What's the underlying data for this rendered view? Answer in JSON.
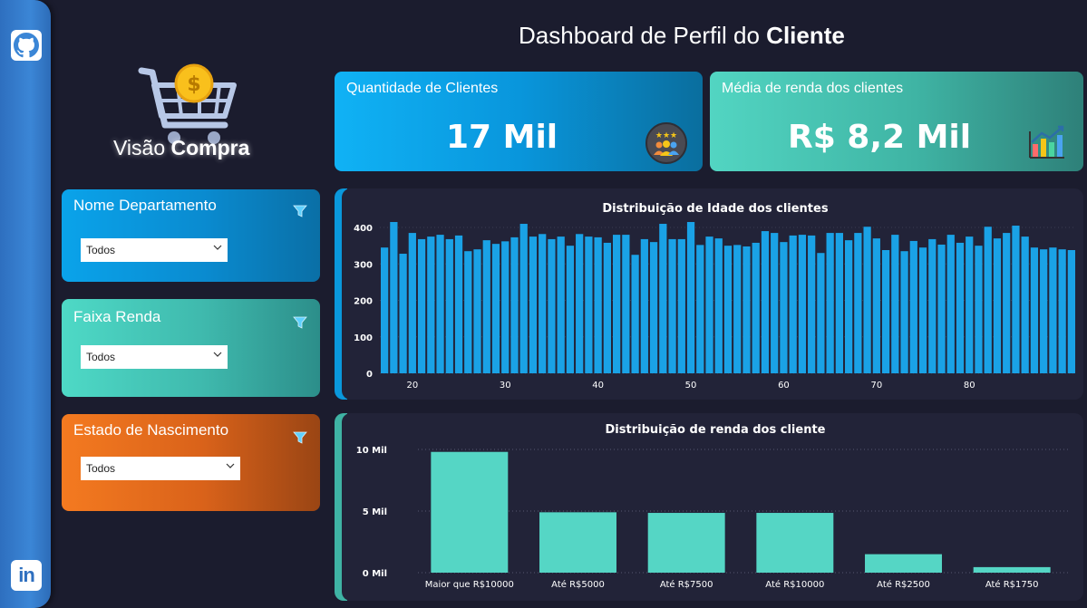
{
  "title": {
    "prefix": "Dashboard de Perfil do ",
    "bold": "Cliente"
  },
  "logo": {
    "prefix": "Visão ",
    "bold": "Compra"
  },
  "rail": {
    "top_icon": "github-icon",
    "bottom_icon": "linkedin-icon",
    "bottom_label": "in"
  },
  "filters": [
    {
      "label": "Nome Departamento",
      "value": "Todos"
    },
    {
      "label": "Faixa Renda",
      "value": "Todos"
    },
    {
      "label": "Estado de Nascimento",
      "value": "Todos"
    }
  ],
  "kpis": [
    {
      "label": "Quantidade de Clientes",
      "value": "17 Mil",
      "icon": "customers-rating-icon"
    },
    {
      "label": "Média de renda dos clientes",
      "value": "R$ 8,2 Mil",
      "icon": "growth-chart-icon"
    }
  ],
  "colors": {
    "age_bars": "#1aa2e6",
    "income_bars": "#55d6c5",
    "background": "#1b1c2e",
    "panel": "#222338"
  },
  "chart_data": [
    {
      "type": "bar",
      "title": "Distribuição de Idade dos clientes",
      "xlabel": "",
      "ylabel": "",
      "x_ticks": [
        20,
        30,
        40,
        50,
        60,
        70,
        80
      ],
      "y_ticks": [
        0,
        100,
        200,
        300,
        400
      ],
      "ylim": [
        0,
        420
      ],
      "x": [
        17,
        18,
        19,
        20,
        21,
        22,
        23,
        24,
        25,
        26,
        27,
        28,
        29,
        30,
        31,
        32,
        33,
        34,
        35,
        36,
        37,
        38,
        39,
        40,
        41,
        42,
        43,
        44,
        45,
        46,
        47,
        48,
        49,
        50,
        51,
        52,
        53,
        54,
        55,
        56,
        57,
        58,
        59,
        60,
        61,
        62,
        63,
        64,
        65,
        66,
        67,
        68,
        69,
        70,
        71,
        72,
        73,
        74,
        75,
        76,
        77,
        78,
        79,
        80,
        81,
        82,
        83,
        84,
        85,
        86,
        87,
        88,
        89
      ],
      "values": [
        345,
        415,
        328,
        385,
        368,
        375,
        380,
        368,
        378,
        335,
        340,
        365,
        355,
        362,
        373,
        410,
        375,
        382,
        368,
        375,
        350,
        382,
        375,
        373,
        358,
        380,
        380,
        325,
        368,
        360,
        410,
        368,
        368,
        415,
        352,
        375,
        370,
        350,
        352,
        348,
        358,
        390,
        385,
        360,
        378,
        380,
        378,
        330,
        385,
        385,
        365,
        385,
        402,
        370,
        338,
        380,
        335,
        363,
        345,
        368,
        353,
        380,
        358,
        375,
        350,
        402,
        370,
        385,
        405,
        375,
        345,
        340,
        345,
        340,
        338
      ]
    },
    {
      "type": "bar",
      "title": "Distribuição de renda dos cliente",
      "xlabel": "",
      "ylabel": "",
      "categories": [
        "Maior que R$10000",
        "Até R$5000",
        "Até R$7500",
        "Até R$10000",
        "Até R$2500",
        "Até R$1750"
      ],
      "values": [
        9800,
        4900,
        4850,
        4850,
        1500,
        450
      ],
      "y_ticks": [
        "0 Mil",
        "5 Mil",
        "10 Mil"
      ],
      "ylim": [
        0,
        10000
      ]
    }
  ]
}
